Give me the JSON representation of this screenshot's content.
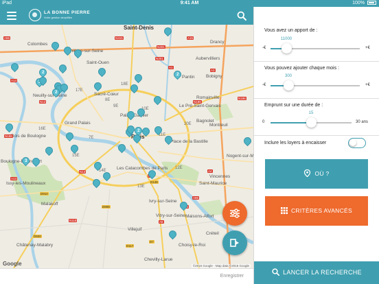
{
  "status_bar": {
    "device": "iPad",
    "time": "9:41 AM",
    "battery": "100%"
  },
  "header": {
    "logo_title": "LA BONNE PIERRE",
    "logo_subtitle": "Votre gestion simplifiée"
  },
  "map": {
    "labels": [
      {
        "text": "Saint-Denis",
        "cls": "big"
      },
      {
        "text": "Colombes"
      },
      {
        "text": "Asnières-sur-Seine"
      },
      {
        "text": "Drancy"
      },
      {
        "text": "Aubervilliers"
      },
      {
        "text": "Neuilly-sur-Seine"
      },
      {
        "text": "Sacré-Cœur"
      },
      {
        "text": "Pantin"
      },
      {
        "text": "Bobigny"
      },
      {
        "text": "Grand Palais"
      },
      {
        "text": "Palais Garnier"
      },
      {
        "text": "Bagnolet"
      },
      {
        "text": "Montreuil"
      },
      {
        "text": "Bois de Boulogne"
      },
      {
        "text": "Paris",
        "cls": "big"
      },
      {
        "text": "Place de la Bastille"
      },
      {
        "text": "Boulogne-Billancourt"
      },
      {
        "text": "Les Catacombes de Paris"
      },
      {
        "text": "Vincennes"
      },
      {
        "text": "Issy-les-Moulineaux"
      },
      {
        "text": "Saint-Maurice"
      },
      {
        "text": "Malakoff"
      },
      {
        "text": "Ivry-sur-Seine"
      },
      {
        "text": "Vitry-sur-Seine"
      },
      {
        "text": "Maisons-Alfort"
      },
      {
        "text": "Châtenay-Malabry"
      },
      {
        "text": "Villejuif"
      },
      {
        "text": "Chevilly-Larue"
      },
      {
        "text": "Choisy-le-Roi"
      },
      {
        "text": "Créteil"
      },
      {
        "text": "Romainville"
      },
      {
        "text": "Le Pré-Saint-Gervais"
      },
      {
        "text": "Saint-Ouen"
      },
      {
        "text": "Nogent-sur-Marne"
      }
    ],
    "districts": [
      "8E",
      "9E",
      "19E",
      "18E",
      "17E",
      "20E",
      "16E",
      "15E",
      "14E",
      "12E",
      "11E",
      "10E",
      "13E",
      "7E"
    ],
    "road_badges": [
      "A86",
      "N315",
      "A15",
      "A1",
      "N301",
      "A3",
      "N186",
      "A14",
      "N13",
      "A13",
      "D910",
      "A4",
      "N6",
      "A6",
      "N118",
      "D920",
      "A86",
      "D906",
      "D7",
      "N186",
      "N301",
      "D117",
      "D148",
      "N13",
      "N186",
      "A86"
    ],
    "google": "Google",
    "attribution": "©2016 Google - Map data ©2016 Google"
  },
  "bottom": {
    "save_label": "Enregistrer"
  },
  "panel": {
    "apport": {
      "label": "Vous avez un apport de :",
      "value": "11000",
      "min": "-€",
      "max": "+€",
      "fraction": 0.18
    },
    "mensuel": {
      "label": "Vous pouvez ajouter chaque mois :",
      "value": "300",
      "min": "-€",
      "max": "+€",
      "fraction": 0.2
    },
    "duree": {
      "label": "Emprunt sur une durée de :",
      "value": "15",
      "min": "0",
      "max": "30 ans",
      "fraction": 0.5
    },
    "loyers": {
      "label": "Inclure les loyers à encaisser",
      "enabled": false
    },
    "where_button": "OÙ ?",
    "criteria_button": "CRITÈRES AVANCÉS",
    "launch_button": "LANCER LA RECHERCHE"
  },
  "colors": {
    "primary": "#3f9fb0",
    "accent": "#ee6a2d",
    "marker": "#4fb3c6"
  },
  "icons": [
    "menu-icon",
    "search-icon",
    "map-pin-icon",
    "filters-icon",
    "navigate-icon",
    "location-icon",
    "grid-icon"
  ]
}
